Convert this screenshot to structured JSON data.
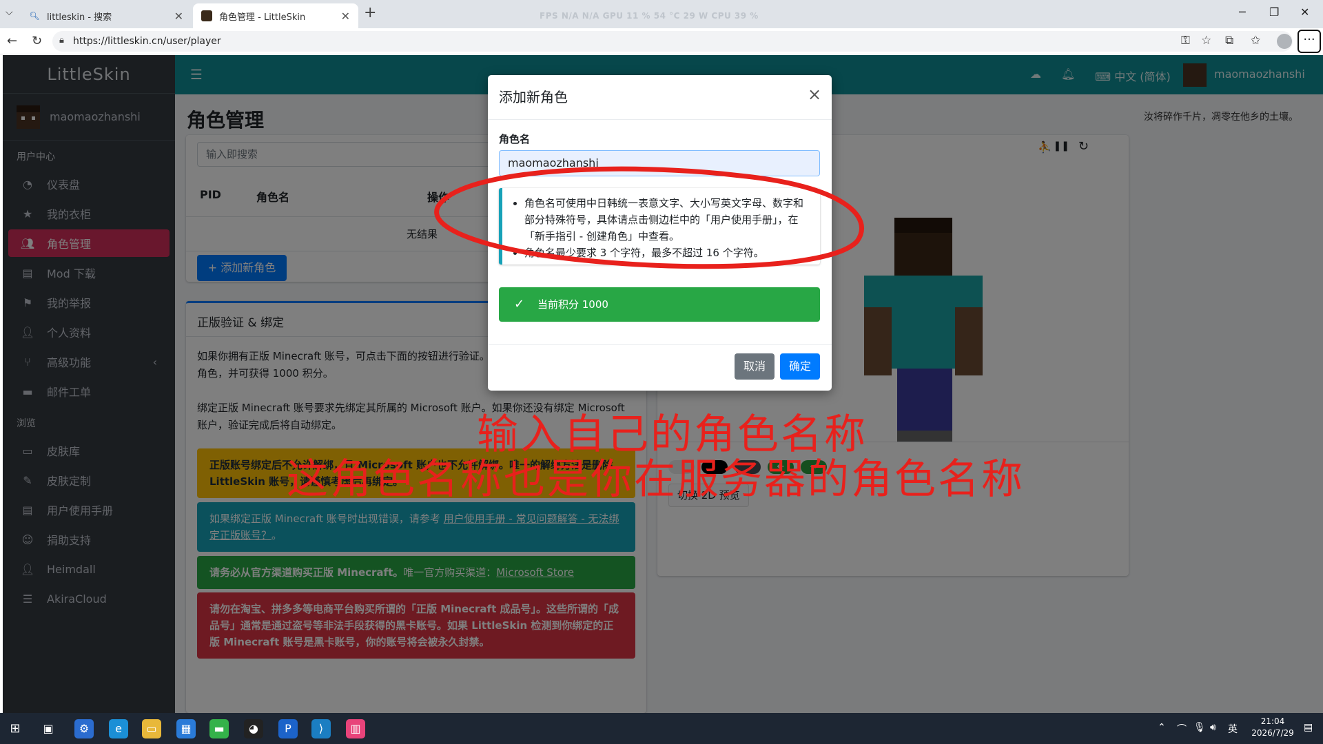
{
  "browser": {
    "tabs": [
      {
        "title": "littleskin - 搜索",
        "icon": "search-icon"
      },
      {
        "title": "角色管理 - LittleSkin",
        "icon": "littleskin-favicon"
      }
    ],
    "perf": "FPS  N/A  N/A    GPU  11 %  54 °C  29 W    CPU  39 %",
    "url": "https://littleskin.cn/user/player"
  },
  "sidebar": {
    "brand": "LittleSkin",
    "username": "maomaozhanshi",
    "section_user": "用户中心",
    "user_items": [
      {
        "label": "仪表盘",
        "icon": "dashboard-icon"
      },
      {
        "label": "我的衣柜",
        "icon": "star-icon"
      },
      {
        "label": "角色管理",
        "icon": "users-icon",
        "active": true
      },
      {
        "label": "Mod 下载",
        "icon": "file-icon"
      },
      {
        "label": "我的举报",
        "icon": "flag-icon"
      },
      {
        "label": "个人资料",
        "icon": "user-icon"
      },
      {
        "label": "高级功能",
        "icon": "branch-icon"
      },
      {
        "label": "邮件工单",
        "icon": "ticket-icon"
      }
    ],
    "section_browse": "浏览",
    "browse_items": [
      {
        "label": "皮肤库",
        "icon": "archive-icon"
      },
      {
        "label": "皮肤定制",
        "icon": "pencil-icon"
      },
      {
        "label": "用户使用手册",
        "icon": "book-icon"
      },
      {
        "label": "捐助支持",
        "icon": "donate-icon"
      },
      {
        "label": "Heimdall",
        "icon": "user-shield-icon"
      },
      {
        "label": "AkiraCloud",
        "icon": "server-icon"
      }
    ]
  },
  "topnav": {
    "language": "中文 (简体)",
    "username": "maomaozhanshi"
  },
  "page": {
    "title": "角色管理",
    "motto": "汝将碎作千片，凋零在他乡的土壤。",
    "search_placeholder": "输入即搜索",
    "columns": [
      "PID",
      "角色名",
      "操作"
    ],
    "empty": "无结果",
    "add_button": "添加新角色"
  },
  "verify": {
    "title": "正版验证 & 绑定",
    "para1": "如果你拥有正版 Minecraft 账号，可点击下面的按钮进行验证。验证成功后将会添加一个对应的角色，并可获得 1000 积分。",
    "para2": "绑定正版 Minecraft 账号要求先绑定其所属的 Microsoft 账户。如果你还没有绑定 Microsoft 账户，验证完成后将自动绑定。",
    "warn": "正版账号绑定后不允许解绑，且 Microsoft 账户也不允许解绑。唯一的解绑方法是删除 LittleSkin 账号，请谨慎考虑后再绑定。",
    "info_prefix": "如果绑定正版 Minecraft 账号时出现错误，请参考 ",
    "info_link": "用户使用手册 - 常见问题解答 - 无法绑定正版账号？",
    "info_suffix": "。",
    "success_bold": "请务必从官方渠道购买正版 Minecraft。",
    "success_rest": "唯一官方购买渠道：",
    "success_link": "Microsoft Store",
    "danger": "请勿在淘宝、拼多多等电商平台购买所谓的「正版 Minecraft 成品号」。这些所谓的「成品号」通常是通过盗号等非法手段获得的黑卡账号。如果 LittleSkin 检测到你绑定的正版 Minecraft 账号是黑卡账号，你的账号将会被永久封禁。"
  },
  "preview": {
    "toggle_2d": "切换 2D 预览"
  },
  "modal": {
    "title": "添加新角色",
    "field_label": "角色名",
    "input_value": "maomaozhanshi",
    "rules": [
      "角色名可使用中日韩统一表意文字、大小写英文字母、数字和部分特殊符号，具体请点击侧边栏中的「用户使用手册」，在「新手指引 - 创建角色」中查看。",
      "角色名最少要求 3 个字符，最多不超过 16 个字符。"
    ],
    "points": "当前积分 1000",
    "cancel": "取消",
    "confirm": "确定"
  },
  "annotations": {
    "line1": "输入自己的角色名称",
    "line2": "这角色名称也是你在服务器的角色名称"
  },
  "taskbar": {
    "ime": "英",
    "time": "21:04",
    "date": "2026/7/29"
  },
  "colors": {
    "topnav": "#0e8e96",
    "sidebar": "#343a40",
    "active_nav": "#d32f5b",
    "primary": "#007bff",
    "success": "#28a745",
    "annotation": "#e8211c"
  }
}
